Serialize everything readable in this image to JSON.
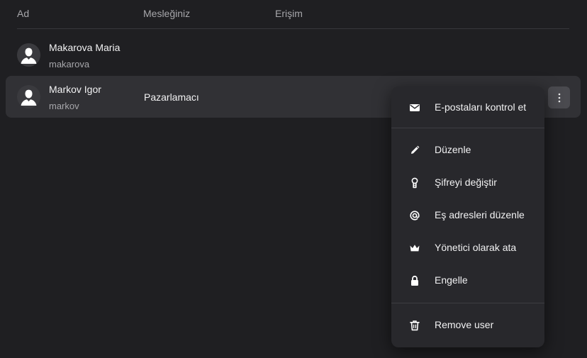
{
  "table": {
    "columns": {
      "name": "Ad",
      "profession": "Mesleğiniz",
      "access": "Erişim"
    },
    "users": [
      {
        "name": "Makarova Maria",
        "login": "makarova",
        "profession": ""
      },
      {
        "name": "Markov Igor",
        "login": "markov",
        "profession": "Pazarlamacı"
      }
    ]
  },
  "menu": {
    "items": [
      {
        "label": "E-postaları kontrol et",
        "icon": "envelope-icon"
      },
      {
        "label": "Düzenle",
        "icon": "pencil-icon"
      },
      {
        "label": "Şifreyi değiştir",
        "icon": "key-icon"
      },
      {
        "label": "Eş adresleri düzenle",
        "icon": "at-sign-icon"
      },
      {
        "label": "Yönetici olarak ata",
        "icon": "crown-icon"
      },
      {
        "label": "Engelle",
        "icon": "lock-icon"
      },
      {
        "label": "Remove user",
        "icon": "trash-icon"
      }
    ]
  },
  "colors": {
    "background": "#1f1f22",
    "row_selected": "#313135",
    "menu_background": "#28282c"
  }
}
